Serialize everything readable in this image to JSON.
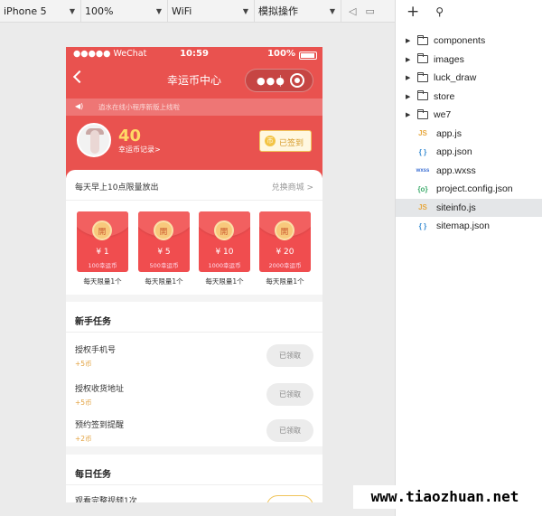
{
  "toolbar": {
    "device": "iPhone 5",
    "zoom": "100%",
    "network": "WiFi",
    "operation": "模拟操作"
  },
  "status_bar": {
    "carrier": "●●●●● WeChat",
    "time": "10:59",
    "battery": "100%"
  },
  "nav": {
    "title": "幸运币中心"
  },
  "notice": {
    "text": "逍水在线小程序新版上线啦"
  },
  "user": {
    "coins": "40",
    "record_link": "幸运币记录>",
    "signed_label": "已签到"
  },
  "exchange": {
    "header": "每天早上10点限量放出",
    "link": "兑换商城 >",
    "packets": [
      {
        "badge": "開",
        "amount": "¥ 1",
        "cost": "100幸运币",
        "limit": "每天限量1个"
      },
      {
        "badge": "開",
        "amount": "¥ 5",
        "cost": "500幸运币",
        "limit": "每天限量1个"
      },
      {
        "badge": "開",
        "amount": "¥ 10",
        "cost": "1000幸运币",
        "limit": "每天限量1个"
      },
      {
        "badge": "開",
        "amount": "¥ 20",
        "cost": "2000幸运币",
        "limit": "每天限量1个"
      }
    ]
  },
  "newbie": {
    "title": "新手任务",
    "tasks": [
      {
        "name": "授权手机号",
        "points": "+5币",
        "button": "已领取"
      },
      {
        "name": "授权收货地址",
        "points": "+5币",
        "button": "已领取"
      },
      {
        "name": "预约签到提醒",
        "points": "+2币",
        "button": "已领取"
      }
    ]
  },
  "daily": {
    "title": "每日任务",
    "tasks": [
      {
        "name": "观看完整视频1次",
        "button": ""
      }
    ]
  },
  "files": {
    "folders": [
      "components",
      "images",
      "luck_draw",
      "store",
      "we7"
    ],
    "files": [
      {
        "icon": "JS",
        "name": "app.js"
      },
      {
        "icon": "{ }",
        "name": "app.json"
      },
      {
        "icon": "wxss",
        "name": "app.wxss"
      },
      {
        "icon": "{o}",
        "name": "project.config.json"
      },
      {
        "icon": "JS",
        "name": "siteinfo.js"
      },
      {
        "icon": "{ }",
        "name": "sitemap.json"
      }
    ]
  },
  "watermark": "www.tiaozhuan.net",
  "colors": {
    "header_red": "#e9524f",
    "gold": "#ffd866",
    "accent_orange": "#e2a03c"
  }
}
